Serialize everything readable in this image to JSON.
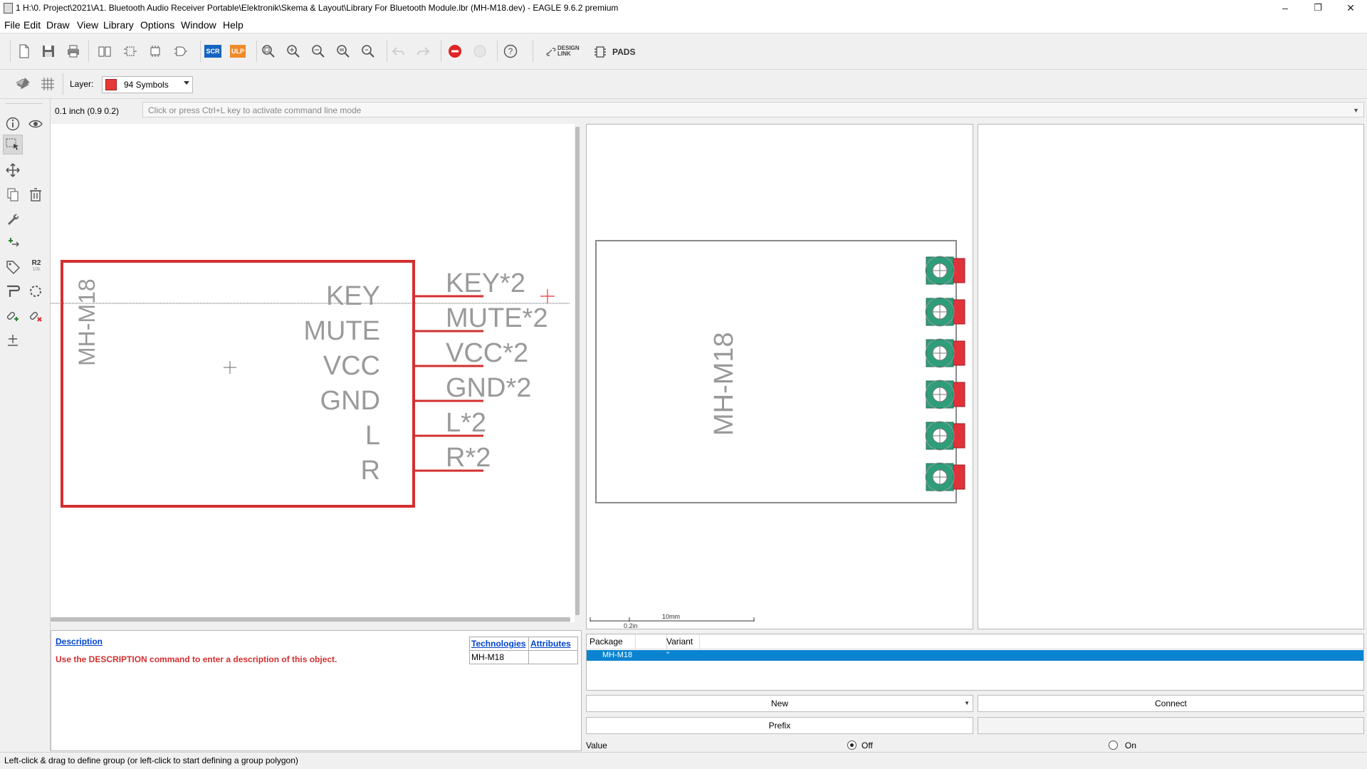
{
  "window": {
    "title": "1 H:\\0. Project\\2021\\A1. Bluetooth Audio Receiver Portable\\Elektronik\\Skema & Layout\\Library For Bluetooth Module.lbr (MH-M18.dev) - EAGLE 9.6.2 premium",
    "minimize": "–",
    "restore": "❐",
    "close": "✕"
  },
  "menu": [
    "File",
    "Edit",
    "Draw",
    "View",
    "Library",
    "Options",
    "Window",
    "Help"
  ],
  "toolbar": {
    "scr_label": "SCR",
    "ulp_label": "ULP",
    "design_link_line1": "DESIGN",
    "design_link_line2": "LINK",
    "pads_label": "PADS",
    "help_glyph": "?"
  },
  "layer": {
    "label": "Layer:",
    "selected": "94 Symbols",
    "color": "#e53935"
  },
  "command": {
    "coordinate": "0.1 inch (0.9 0.2)",
    "placeholder": "Click or press Ctrl+L key to activate command line mode"
  },
  "left_toolbar": {
    "r2_label": "R2",
    "r2_sub": "10k"
  },
  "symbol": {
    "name": "MH-M18",
    "pins": [
      "KEY",
      "MUTE",
      "VCC",
      "GND",
      "L",
      "R"
    ],
    "pin_labels": [
      "KEY*2",
      "MUTE*2",
      "VCC*2",
      "GND*2",
      "L*2",
      "R*2"
    ]
  },
  "footprint": {
    "name": "MH-M18",
    "pad_count": 6,
    "scale_label_top": "10mm",
    "scale_label_bottom": "0.2in"
  },
  "description": {
    "heading": "Description",
    "text": "Use the DESCRIPTION command to enter a description of this object.",
    "tech_header": "Technologies",
    "attr_header": "Attributes",
    "tech_value": "MH-M18",
    "attr_value": ""
  },
  "packages": {
    "col_package": "Package",
    "col_variant": "Variant",
    "rows": [
      {
        "package": "MH-M18",
        "variant": "''"
      }
    ]
  },
  "buttons": {
    "new": "New",
    "connect": "Connect",
    "prefix": "Prefix"
  },
  "value": {
    "label": "Value",
    "off": "Off",
    "on": "On",
    "selected": "Off"
  },
  "status": "Left-click & drag to define group (or left-click to start defining a group polygon)"
}
